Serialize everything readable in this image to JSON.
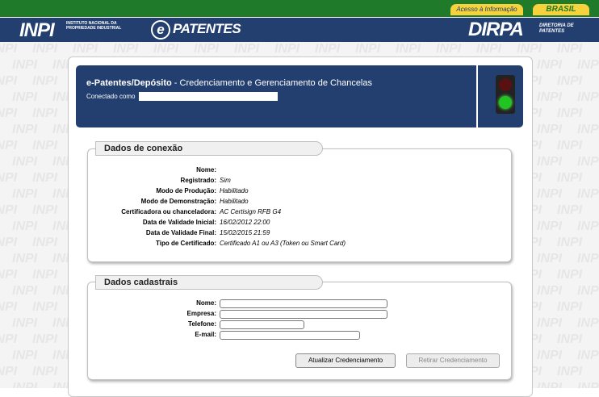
{
  "gov_bar": {
    "access_label": "Acesso à Informação",
    "brasil_label": "BRASIL"
  },
  "header": {
    "inpi_logo": "INPI",
    "inpi_subtitle": "INSTITUTO NACIONAL DA PROPRIEDADE INDUSTRIAL",
    "epatentes_mark": "e",
    "epatentes_text": "PATENTES",
    "dirpa_logo": "DIRPA",
    "dirpa_subtitle": "DIRETORIA DE PATENTES"
  },
  "watermark_text": "INPI",
  "banner": {
    "title_bold": "e-Patentes/Depósito",
    "title_rest": " - Credenciamento e Gerenciamento de Chancelas",
    "connected_label": "Conectado como",
    "connected_user": "",
    "status_light": "green"
  },
  "connection": {
    "title": "Dados de conexão",
    "fields": [
      {
        "label": "Nome:",
        "value": ""
      },
      {
        "label": "Registrado:",
        "value": "Sim"
      },
      {
        "label": "Modo de Produção:",
        "value": "Habilitado"
      },
      {
        "label": "Modo de Demonstração:",
        "value": "Habilitado"
      },
      {
        "label": "Certificadora ou chanceladora:",
        "value": "AC Certisign RFB G4"
      },
      {
        "label": "Data de Validade Inicial:",
        "value": "16/02/2012 22:00"
      },
      {
        "label": "Data de Validade Final:",
        "value": "15/02/2015 21:59"
      },
      {
        "label": "Tipo de Certificado:",
        "value": "Certificado A1 ou A3 (Token ou Smart Card)"
      }
    ]
  },
  "registration": {
    "title": "Dados cadastrais",
    "fields": [
      {
        "label": "Nome:",
        "value": ""
      },
      {
        "label": "Empresa:",
        "value": ""
      },
      {
        "label": "Telefone:",
        "value": ""
      },
      {
        "label": "E-mail:",
        "value": ""
      }
    ],
    "update_button": "Atualizar Credenciamento",
    "remove_button": "Retirar Credenciamento"
  }
}
